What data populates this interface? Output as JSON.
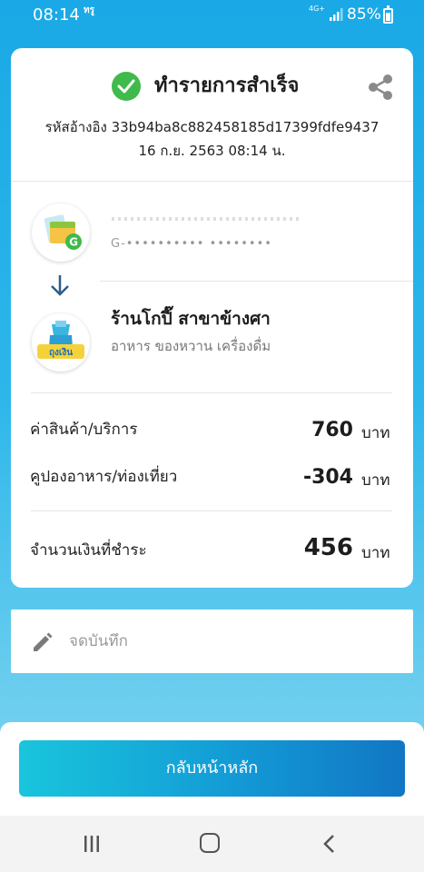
{
  "status_bar": {
    "time": "08:14",
    "app_indicator": "ทรู",
    "network": "4G+",
    "battery": "85%"
  },
  "receipt": {
    "title": "ทำรายการสำเร็จ",
    "reference": "รหัสอ้างอิง 33b94ba8c882458185d17399fdfe9437",
    "datetime": "16 ก.ย. 2563 08:14 น.",
    "sender": {
      "name": "",
      "account": "G-•••••••••• ••••••••"
    },
    "merchant": {
      "name": "ร้านโกปี๊ สาขาข้างศา",
      "category": "อาหาร ของหวาน เครื่องดื่ม"
    },
    "lines": [
      {
        "label": "ค่าสินค้า/บริการ",
        "value": "760",
        "unit": "บาท"
      },
      {
        "label": "คูปองอาหาร/ท่องเที่ยว",
        "value": "-304",
        "unit": "บาท"
      }
    ],
    "total": {
      "label": "จำนวนเงินที่ชำระ",
      "value": "456",
      "unit": "บาท"
    }
  },
  "note": {
    "value": "",
    "placeholder": "จดบันทึก"
  },
  "home_button": "กลับหน้าหลัก",
  "merchant_logo_text": "ถุงเงิน",
  "wallet_logo_letter": "G",
  "colors": {
    "success": "#3fba4b",
    "accent": "#139bd6",
    "background": "#1aa9e6"
  },
  "icons": [
    "check-icon",
    "share-icon",
    "arrow-down-icon",
    "pencil-icon",
    "wallet-logo",
    "merchant-logo"
  ]
}
